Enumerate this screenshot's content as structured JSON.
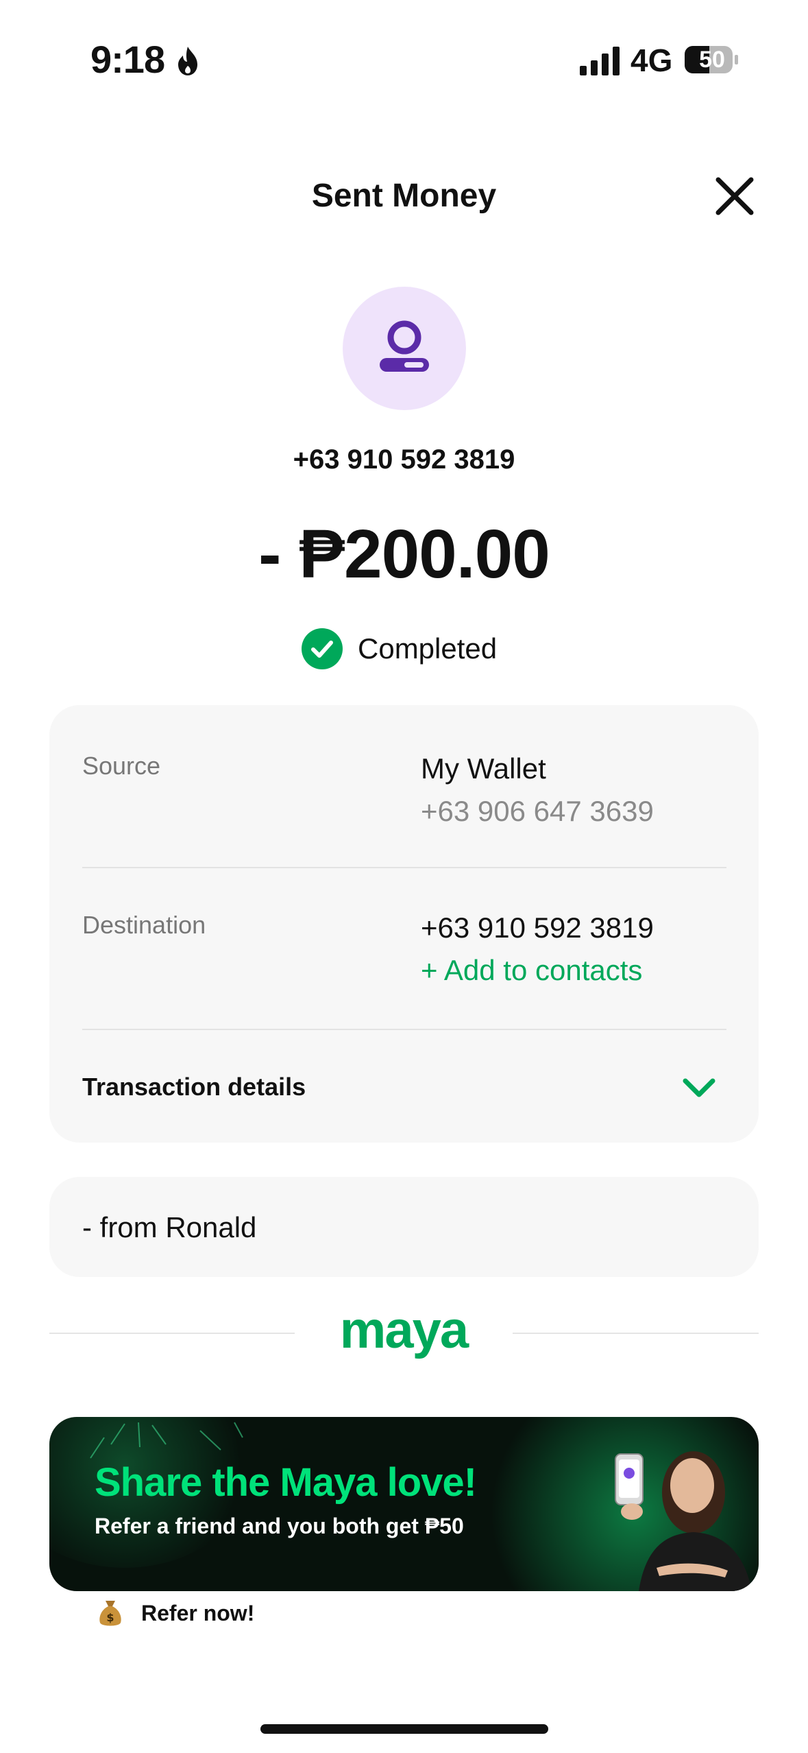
{
  "status_bar": {
    "time": "9:18",
    "network": "4G",
    "battery": "50"
  },
  "header": {
    "title": "Sent Money"
  },
  "recipient": {
    "number": "+63 910 592 3819",
    "avatar_color": "#efe3fb",
    "avatar_icon_color": "#5b2ba8"
  },
  "transaction": {
    "amount": "- ₱200.00",
    "status": "Completed",
    "status_color": "#00a85a"
  },
  "details": {
    "source_label": "Source",
    "source_value": "My Wallet",
    "source_number": "+63 906 647 3639",
    "destination_label": "Destination",
    "destination_value": "+63 910 592 3819",
    "add_contact_label": "+ Add to contacts",
    "transaction_details_label": "Transaction details"
  },
  "note": {
    "text": "- from Ronald"
  },
  "brand": {
    "logo_text": "maya",
    "accent": "#00a85a"
  },
  "banner": {
    "title": "Share the Maya love!",
    "subtitle": "Refer a friend and you both get ₱50",
    "title_color": "#00e27a"
  },
  "refer": {
    "icon": "money-bag-icon",
    "label": "Refer now!"
  },
  "icons": {
    "close": "close-icon",
    "check": "check-circle-icon",
    "chevron": "chevron-down-icon",
    "avatar": "user-icon"
  }
}
